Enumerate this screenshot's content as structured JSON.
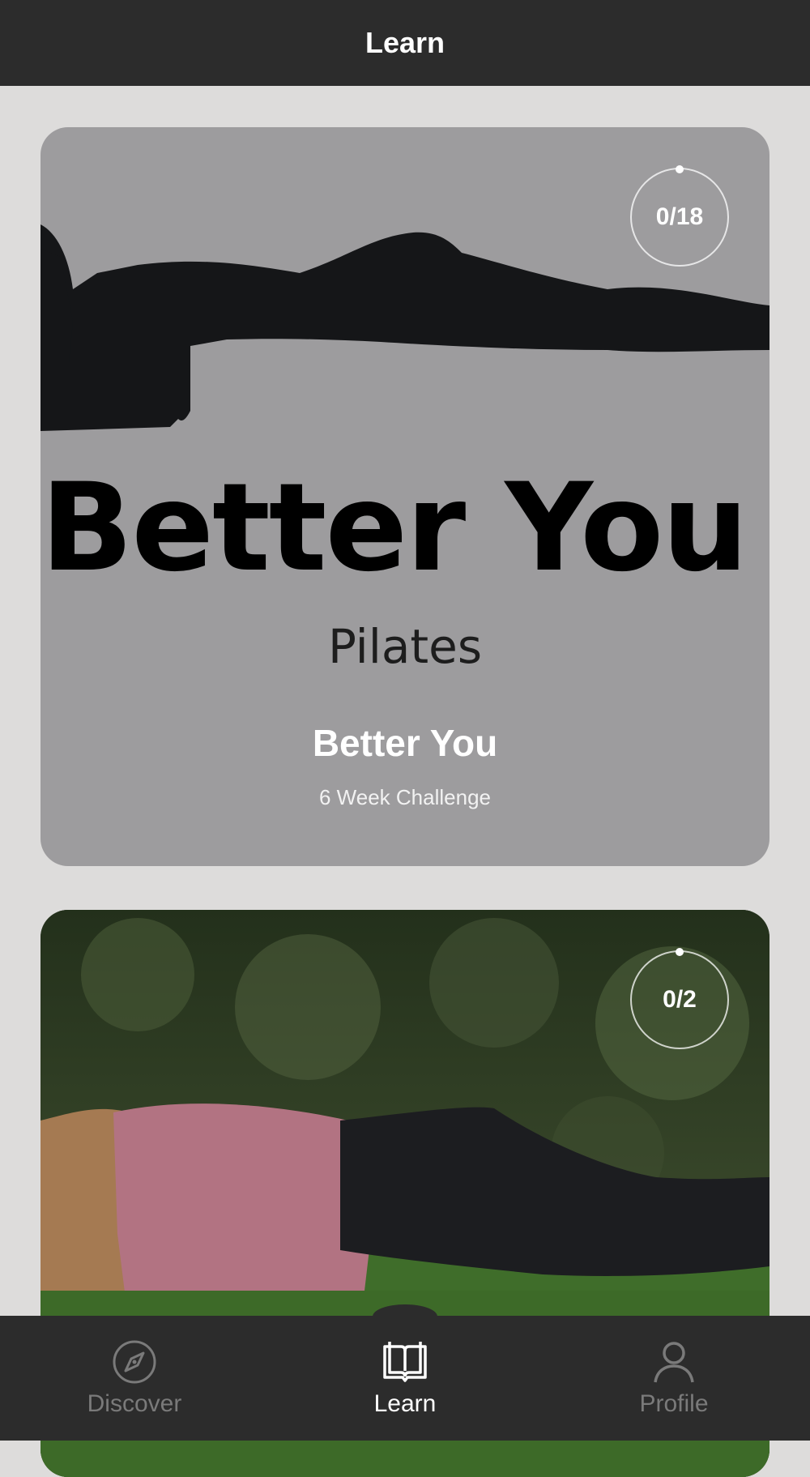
{
  "header": {
    "title": "Learn"
  },
  "cards": [
    {
      "progress": "0/18",
      "art_title": "Better You",
      "art_subtitle": "Pilates",
      "title": "Better You",
      "subtitle": "6 Week Challenge"
    },
    {
      "progress": "0/2"
    }
  ],
  "tabbar": {
    "items": [
      {
        "label": "Discover",
        "icon": "compass-icon",
        "active": false
      },
      {
        "label": "Learn",
        "icon": "book-icon",
        "active": true
      },
      {
        "label": "Profile",
        "icon": "person-icon",
        "active": false
      }
    ]
  },
  "colors": {
    "header_bg": "#2c2c2c",
    "page_bg": "#dddcdb",
    "tab_inactive": "#7a7a7a",
    "tab_active": "#ffffff"
  }
}
